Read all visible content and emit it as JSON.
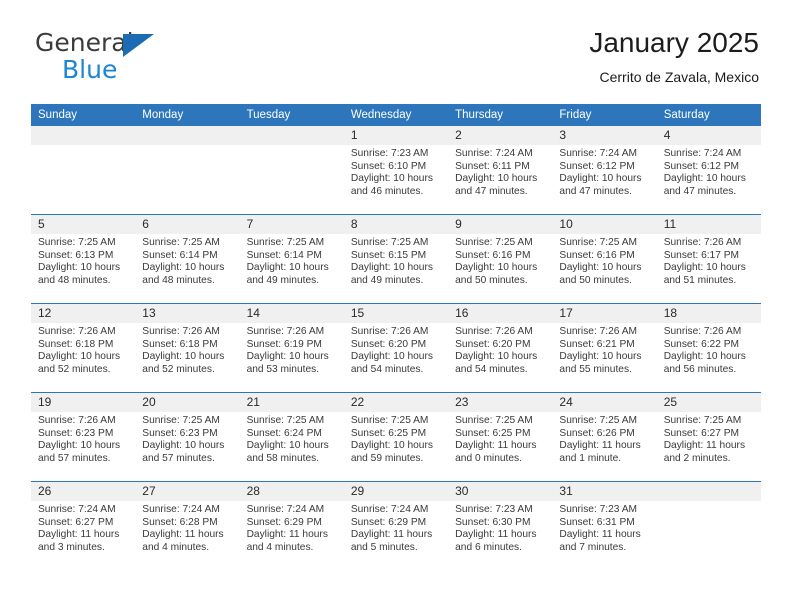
{
  "brand": {
    "name_top": "General",
    "name_bottom": "Blue",
    "triangle_color": "#1c6cb5",
    "blue_color": "#1e85d0"
  },
  "header": {
    "title": "January 2025",
    "subtitle": "Cerrito de Zavala, Mexico"
  },
  "theme": {
    "header_bg": "#2d76bb",
    "header_text": "#ffffff",
    "day_band_bg": "#f0f0f0",
    "row_divider": "#2d76bb",
    "body_text": "#3a3a3a"
  },
  "weekdays": [
    "Sunday",
    "Monday",
    "Tuesday",
    "Wednesday",
    "Thursday",
    "Friday",
    "Saturday"
  ],
  "labels": {
    "sunrise": "Sunrise:",
    "sunset": "Sunset:",
    "daylight": "Daylight:"
  },
  "weeks": [
    [
      {
        "day": "",
        "sunrise": "",
        "sunset": "",
        "daylight_l1": "",
        "daylight_l2": ""
      },
      {
        "day": "",
        "sunrise": "",
        "sunset": "",
        "daylight_l1": "",
        "daylight_l2": ""
      },
      {
        "day": "",
        "sunrise": "",
        "sunset": "",
        "daylight_l1": "",
        "daylight_l2": ""
      },
      {
        "day": "1",
        "sunrise": "Sunrise: 7:23 AM",
        "sunset": "Sunset: 6:10 PM",
        "daylight_l1": "Daylight: 10 hours",
        "daylight_l2": "and 46 minutes."
      },
      {
        "day": "2",
        "sunrise": "Sunrise: 7:24 AM",
        "sunset": "Sunset: 6:11 PM",
        "daylight_l1": "Daylight: 10 hours",
        "daylight_l2": "and 47 minutes."
      },
      {
        "day": "3",
        "sunrise": "Sunrise: 7:24 AM",
        "sunset": "Sunset: 6:12 PM",
        "daylight_l1": "Daylight: 10 hours",
        "daylight_l2": "and 47 minutes."
      },
      {
        "day": "4",
        "sunrise": "Sunrise: 7:24 AM",
        "sunset": "Sunset: 6:12 PM",
        "daylight_l1": "Daylight: 10 hours",
        "daylight_l2": "and 47 minutes."
      }
    ],
    [
      {
        "day": "5",
        "sunrise": "Sunrise: 7:25 AM",
        "sunset": "Sunset: 6:13 PM",
        "daylight_l1": "Daylight: 10 hours",
        "daylight_l2": "and 48 minutes."
      },
      {
        "day": "6",
        "sunrise": "Sunrise: 7:25 AM",
        "sunset": "Sunset: 6:14 PM",
        "daylight_l1": "Daylight: 10 hours",
        "daylight_l2": "and 48 minutes."
      },
      {
        "day": "7",
        "sunrise": "Sunrise: 7:25 AM",
        "sunset": "Sunset: 6:14 PM",
        "daylight_l1": "Daylight: 10 hours",
        "daylight_l2": "and 49 minutes."
      },
      {
        "day": "8",
        "sunrise": "Sunrise: 7:25 AM",
        "sunset": "Sunset: 6:15 PM",
        "daylight_l1": "Daylight: 10 hours",
        "daylight_l2": "and 49 minutes."
      },
      {
        "day": "9",
        "sunrise": "Sunrise: 7:25 AM",
        "sunset": "Sunset: 6:16 PM",
        "daylight_l1": "Daylight: 10 hours",
        "daylight_l2": "and 50 minutes."
      },
      {
        "day": "10",
        "sunrise": "Sunrise: 7:25 AM",
        "sunset": "Sunset: 6:16 PM",
        "daylight_l1": "Daylight: 10 hours",
        "daylight_l2": "and 50 minutes."
      },
      {
        "day": "11",
        "sunrise": "Sunrise: 7:26 AM",
        "sunset": "Sunset: 6:17 PM",
        "daylight_l1": "Daylight: 10 hours",
        "daylight_l2": "and 51 minutes."
      }
    ],
    [
      {
        "day": "12",
        "sunrise": "Sunrise: 7:26 AM",
        "sunset": "Sunset: 6:18 PM",
        "daylight_l1": "Daylight: 10 hours",
        "daylight_l2": "and 52 minutes."
      },
      {
        "day": "13",
        "sunrise": "Sunrise: 7:26 AM",
        "sunset": "Sunset: 6:18 PM",
        "daylight_l1": "Daylight: 10 hours",
        "daylight_l2": "and 52 minutes."
      },
      {
        "day": "14",
        "sunrise": "Sunrise: 7:26 AM",
        "sunset": "Sunset: 6:19 PM",
        "daylight_l1": "Daylight: 10 hours",
        "daylight_l2": "and 53 minutes."
      },
      {
        "day": "15",
        "sunrise": "Sunrise: 7:26 AM",
        "sunset": "Sunset: 6:20 PM",
        "daylight_l1": "Daylight: 10 hours",
        "daylight_l2": "and 54 minutes."
      },
      {
        "day": "16",
        "sunrise": "Sunrise: 7:26 AM",
        "sunset": "Sunset: 6:20 PM",
        "daylight_l1": "Daylight: 10 hours",
        "daylight_l2": "and 54 minutes."
      },
      {
        "day": "17",
        "sunrise": "Sunrise: 7:26 AM",
        "sunset": "Sunset: 6:21 PM",
        "daylight_l1": "Daylight: 10 hours",
        "daylight_l2": "and 55 minutes."
      },
      {
        "day": "18",
        "sunrise": "Sunrise: 7:26 AM",
        "sunset": "Sunset: 6:22 PM",
        "daylight_l1": "Daylight: 10 hours",
        "daylight_l2": "and 56 minutes."
      }
    ],
    [
      {
        "day": "19",
        "sunrise": "Sunrise: 7:26 AM",
        "sunset": "Sunset: 6:23 PM",
        "daylight_l1": "Daylight: 10 hours",
        "daylight_l2": "and 57 minutes."
      },
      {
        "day": "20",
        "sunrise": "Sunrise: 7:25 AM",
        "sunset": "Sunset: 6:23 PM",
        "daylight_l1": "Daylight: 10 hours",
        "daylight_l2": "and 57 minutes."
      },
      {
        "day": "21",
        "sunrise": "Sunrise: 7:25 AM",
        "sunset": "Sunset: 6:24 PM",
        "daylight_l1": "Daylight: 10 hours",
        "daylight_l2": "and 58 minutes."
      },
      {
        "day": "22",
        "sunrise": "Sunrise: 7:25 AM",
        "sunset": "Sunset: 6:25 PM",
        "daylight_l1": "Daylight: 10 hours",
        "daylight_l2": "and 59 minutes."
      },
      {
        "day": "23",
        "sunrise": "Sunrise: 7:25 AM",
        "sunset": "Sunset: 6:25 PM",
        "daylight_l1": "Daylight: 11 hours",
        "daylight_l2": "and 0 minutes."
      },
      {
        "day": "24",
        "sunrise": "Sunrise: 7:25 AM",
        "sunset": "Sunset: 6:26 PM",
        "daylight_l1": "Daylight: 11 hours",
        "daylight_l2": "and 1 minute."
      },
      {
        "day": "25",
        "sunrise": "Sunrise: 7:25 AM",
        "sunset": "Sunset: 6:27 PM",
        "daylight_l1": "Daylight: 11 hours",
        "daylight_l2": "and 2 minutes."
      }
    ],
    [
      {
        "day": "26",
        "sunrise": "Sunrise: 7:24 AM",
        "sunset": "Sunset: 6:27 PM",
        "daylight_l1": "Daylight: 11 hours",
        "daylight_l2": "and 3 minutes."
      },
      {
        "day": "27",
        "sunrise": "Sunrise: 7:24 AM",
        "sunset": "Sunset: 6:28 PM",
        "daylight_l1": "Daylight: 11 hours",
        "daylight_l2": "and 4 minutes."
      },
      {
        "day": "28",
        "sunrise": "Sunrise: 7:24 AM",
        "sunset": "Sunset: 6:29 PM",
        "daylight_l1": "Daylight: 11 hours",
        "daylight_l2": "and 4 minutes."
      },
      {
        "day": "29",
        "sunrise": "Sunrise: 7:24 AM",
        "sunset": "Sunset: 6:29 PM",
        "daylight_l1": "Daylight: 11 hours",
        "daylight_l2": "and 5 minutes."
      },
      {
        "day": "30",
        "sunrise": "Sunrise: 7:23 AM",
        "sunset": "Sunset: 6:30 PM",
        "daylight_l1": "Daylight: 11 hours",
        "daylight_l2": "and 6 minutes."
      },
      {
        "day": "31",
        "sunrise": "Sunrise: 7:23 AM",
        "sunset": "Sunset: 6:31 PM",
        "daylight_l1": "Daylight: 11 hours",
        "daylight_l2": "and 7 minutes."
      },
      {
        "day": "",
        "sunrise": "",
        "sunset": "",
        "daylight_l1": "",
        "daylight_l2": ""
      }
    ]
  ]
}
